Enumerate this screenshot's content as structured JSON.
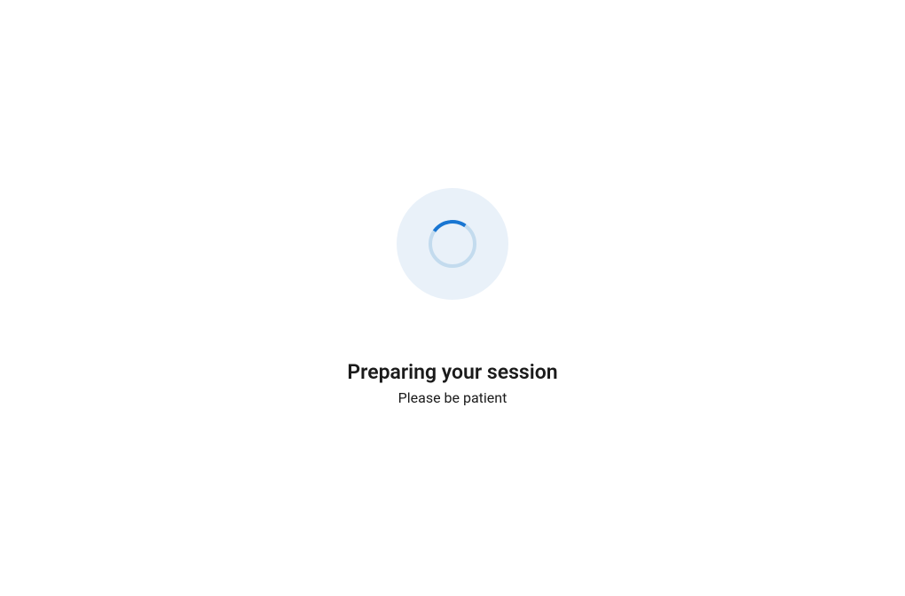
{
  "loading": {
    "title": "Preparing your session",
    "subtitle": "Please be patient"
  },
  "colors": {
    "spinner_bg": "#e9f1f9",
    "spinner_track": "#c3dbee",
    "spinner_arc": "#1976d2",
    "text": "#1b1b1b",
    "background": "#ffffff"
  }
}
